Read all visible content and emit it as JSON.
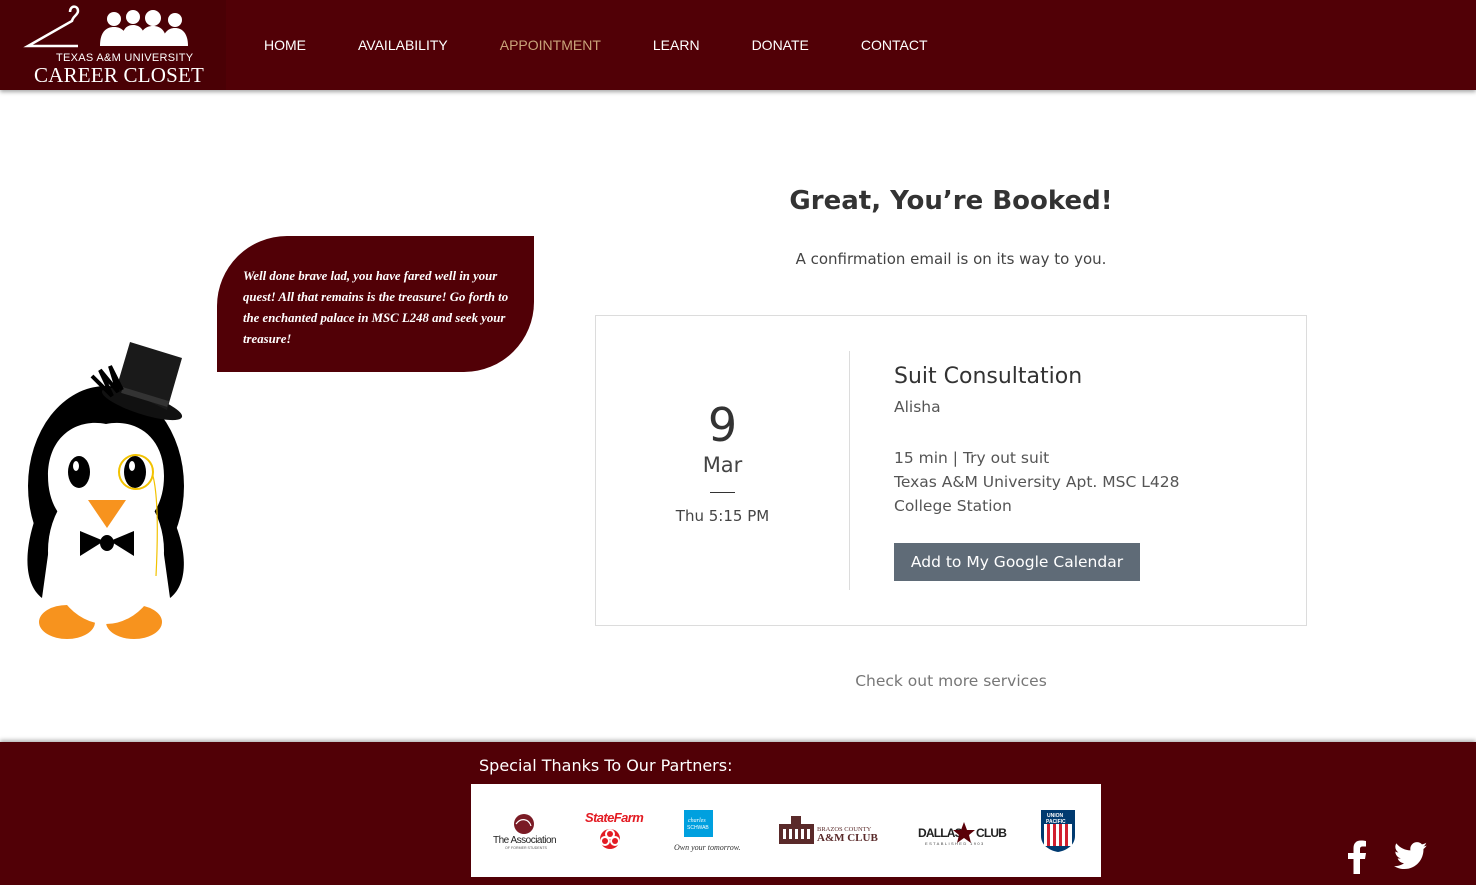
{
  "header": {
    "logo_top": "TEXAS A&M UNIVERSITY",
    "logo_main": "CAREER CLOSET",
    "nav": [
      {
        "label": "HOME"
      },
      {
        "label": "AVAILABILITY"
      },
      {
        "label": "APPOINTMENT",
        "active": true
      },
      {
        "label": "LEARN"
      },
      {
        "label": "DONATE"
      },
      {
        "label": "CONTACT"
      }
    ]
  },
  "bubble": {
    "text": "Well done brave lad, you have fared well in your quest! All that remains is the treasure! Go forth to the enchanted palace in MSC L248 and seek your treasure!"
  },
  "confirmation": {
    "title": "Great, You’re Booked!",
    "subtitle": "A confirmation email is on its way to you.",
    "booking": {
      "day": "9",
      "month": "Mar",
      "time": "Thu 5:15 PM",
      "service": "Suit Consultation",
      "staff": "Alisha",
      "duration_line": "15 min | Try out suit",
      "location_line1": "Texas A&M University Apt. MSC L428",
      "location_line2": "College Station"
    },
    "calendar_button": "Add to My Google Calendar",
    "more_services_link": "Check out more services"
  },
  "footer": {
    "thanks": "Special Thanks To Our Partners:",
    "partners": [
      {
        "name": "The Association of Former Students",
        "text1": "The Association",
        "text2": "OF FORMER STUDENTS"
      },
      {
        "name": "State Farm",
        "text1": "StateFarm"
      },
      {
        "name": "Charles Schwab",
        "text1": "charles",
        "text2": "SCHWAB",
        "text3": "Own your tomorrow."
      },
      {
        "name": "Brazos County A&M Club",
        "text1": "BRAZOS COUNTY",
        "text2": "A&M CLUB"
      },
      {
        "name": "Dallas A&M Club",
        "text1": "DALLAS",
        "text2": "CLUB",
        "text3": "ESTABLISHED 1903"
      },
      {
        "name": "Union Pacific",
        "text1": "UNION",
        "text2": "PACIFIC"
      }
    ],
    "social": [
      {
        "icon": "facebook-icon"
      },
      {
        "icon": "twitter-icon"
      }
    ]
  },
  "colors": {
    "maroon": "#510006",
    "nav_active": "#c9a47a",
    "button": "#5f6b77"
  }
}
